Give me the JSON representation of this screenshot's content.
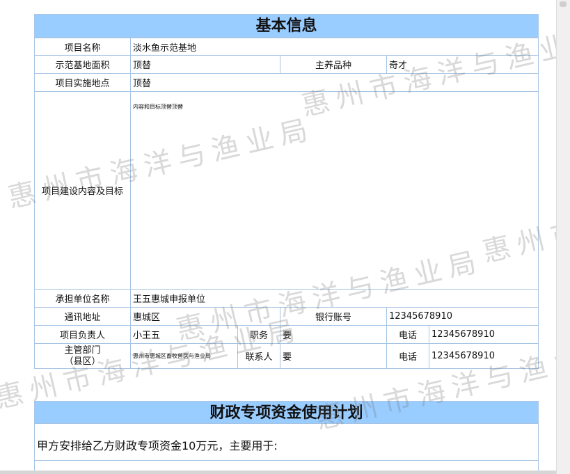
{
  "basic_info": {
    "title": "基本信息",
    "project_name_label": "项目名称",
    "project_name": "淡水鱼示范基地",
    "area_label": "示范基地面积",
    "area_value": "顶替",
    "species_label": "主养品种",
    "species_value": "奇才",
    "location_label": "项目实施地点",
    "location_value": "顶替",
    "content_label": "项目建设内容及目标",
    "content_value": "内容和目标顶替顶替",
    "unit_label": "承担单位名称",
    "unit_value": "王五惠城申报单位",
    "address_label": "通讯地址",
    "address_value": "惠城区",
    "bank_label": "银行账号",
    "bank_value": "12345678910",
    "leader_label": "项目负责人",
    "leader_value": "小王五",
    "position_label": "职务",
    "position_value": "要",
    "phone_label": "电话",
    "phone_value": "12345678910",
    "dept_label": "主管部门\n（县区）",
    "dept_value": "惠州市惠城区畜牧兽医与渔业局",
    "contact_label": "联系人",
    "contact_value": "要",
    "phone2_label": "电话",
    "phone2_value": "12345678910"
  },
  "fund_plan": {
    "title": "财政专项资金使用计划",
    "text": "甲方安排给乙方财政专项资金10万元，主要用于:"
  },
  "watermark": "惠州市海洋与渔业局"
}
